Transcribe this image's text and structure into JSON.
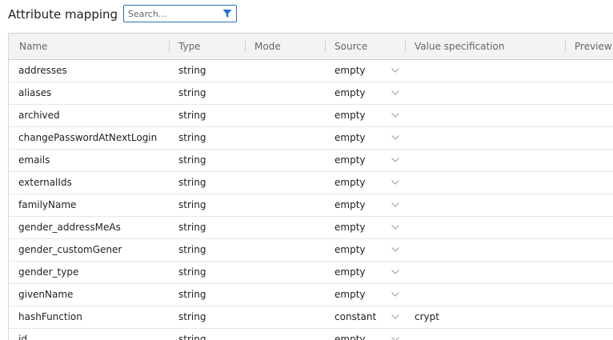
{
  "header": {
    "title": "Attribute mapping",
    "search_placeholder": "Search..."
  },
  "table": {
    "columns": [
      "Name",
      "Type",
      "Mode",
      "Source",
      "Value specification",
      "Preview"
    ],
    "rows": [
      {
        "name": "addresses",
        "type": "string",
        "mode": "",
        "source": "empty",
        "value": ""
      },
      {
        "name": "aliases",
        "type": "string",
        "mode": "",
        "source": "empty",
        "value": ""
      },
      {
        "name": "archived",
        "type": "string",
        "mode": "",
        "source": "empty",
        "value": ""
      },
      {
        "name": "changePasswordAtNextLogin",
        "type": "string",
        "mode": "",
        "source": "empty",
        "value": ""
      },
      {
        "name": "emails",
        "type": "string",
        "mode": "",
        "source": "empty",
        "value": ""
      },
      {
        "name": "externalIds",
        "type": "string",
        "mode": "",
        "source": "empty",
        "value": ""
      },
      {
        "name": "familyName",
        "type": "string",
        "mode": "",
        "source": "empty",
        "value": ""
      },
      {
        "name": "gender_addressMeAs",
        "type": "string",
        "mode": "",
        "source": "empty",
        "value": ""
      },
      {
        "name": "gender_customGener",
        "type": "string",
        "mode": "",
        "source": "empty",
        "value": ""
      },
      {
        "name": "gender_type",
        "type": "string",
        "mode": "",
        "source": "empty",
        "value": ""
      },
      {
        "name": "givenName",
        "type": "string",
        "mode": "",
        "source": "empty",
        "value": ""
      },
      {
        "name": "hashFunction",
        "type": "string",
        "mode": "",
        "source": "constant",
        "value": "crypt"
      },
      {
        "name": "id",
        "type": "string",
        "mode": "",
        "source": "empty",
        "value": ""
      }
    ]
  },
  "icons": {
    "filter": "filter-icon",
    "dropdown": "chevron-down-icon"
  },
  "colors": {
    "accent": "#1a73c8",
    "header_bg": "#f3f3f3",
    "row_border": "#e6e6e6"
  }
}
